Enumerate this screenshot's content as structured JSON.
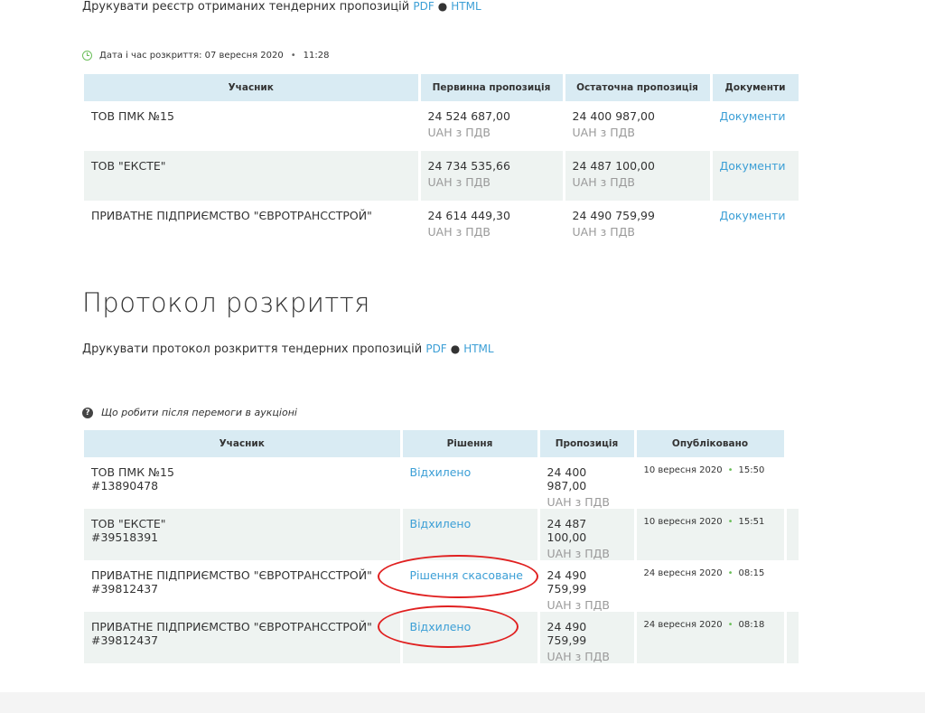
{
  "top_print": {
    "text": "Друкувати реєстр отриманих тендерних пропозицій",
    "pdf": "PDF",
    "html": "HTML"
  },
  "opening": {
    "text": "Дата і час розкриття: 07 вересня 2020",
    "time": "11:28"
  },
  "bids_table": {
    "headers": [
      "Учасник",
      "Первинна пропозиція",
      "Остаточна пропозиція",
      "Документи"
    ],
    "rows": [
      {
        "participant": "ТОВ ПМК №15",
        "initial": "24 524 687,00",
        "initial_vat": "UAH з ПДВ",
        "final": "24 400 987,00",
        "final_vat": "UAH з ПДВ",
        "docs": "Документи"
      },
      {
        "participant": "ТОВ \"ЕКСТЕ\"",
        "initial": "24 734 535,66",
        "initial_vat": "UAH з ПДВ",
        "final": "24 487 100,00",
        "final_vat": "UAH з ПДВ",
        "docs": "Документи"
      },
      {
        "participant": "ПРИВАТНЕ ПІДПРИЄМСТВО \"ЄВРОТРАНССТРОЙ\"",
        "initial": "24 614 449,30",
        "initial_vat": "UAH з ПДВ",
        "final": "24 490 759,99",
        "final_vat": "UAH з ПДВ",
        "docs": "Документи"
      }
    ]
  },
  "protocol": {
    "title": "Протокол розкриття",
    "print_text": "Друкувати протокол розкриття тендерних пропозицій",
    "pdf": "PDF",
    "html": "HTML",
    "help": "Що робити після перемоги в аукціоні"
  },
  "decisions_table": {
    "headers": [
      "Учасник",
      "Рішення",
      "Пропозиція",
      "Опубліковано"
    ],
    "rows": [
      {
        "participant": "ТОВ ПМК №15",
        "id": "#13890478",
        "decision": "Відхилено",
        "amount": "24 400 987,00",
        "vat": "UAH з ПДВ",
        "date": "10 вересня 2020",
        "time": "15:50"
      },
      {
        "participant": "ТОВ \"ЕКСТЕ\"",
        "id": "#39518391",
        "decision": "Відхилено",
        "amount": "24 487 100,00",
        "vat": "UAH з ПДВ",
        "date": "10 вересня 2020",
        "time": "15:51"
      },
      {
        "participant": "ПРИВАТНЕ ПІДПРИЄМСТВО \"ЄВРОТРАНССТРОЙ\"",
        "id": "#39812437",
        "decision": "Рішення скасоване",
        "amount": "24 490 759,99",
        "vat": "UAH з ПДВ",
        "date": "24 вересня 2020",
        "time": "08:15"
      },
      {
        "participant": "ПРИВАТНЕ ПІДПРИЄМСТВО \"ЄВРОТРАНССТРОЙ\"",
        "id": "#39812437",
        "decision": "Відхилено",
        "amount": "24 490 759,99",
        "vat": "UAH з ПДВ",
        "date": "24 вересня 2020",
        "time": "08:18"
      }
    ]
  },
  "colors": {
    "link": "#3c9fd6",
    "header_bg": "#d9ebf3",
    "alt_row": "#eef3f1",
    "highlight": "#e02020",
    "clock": "#6cbf5b"
  }
}
